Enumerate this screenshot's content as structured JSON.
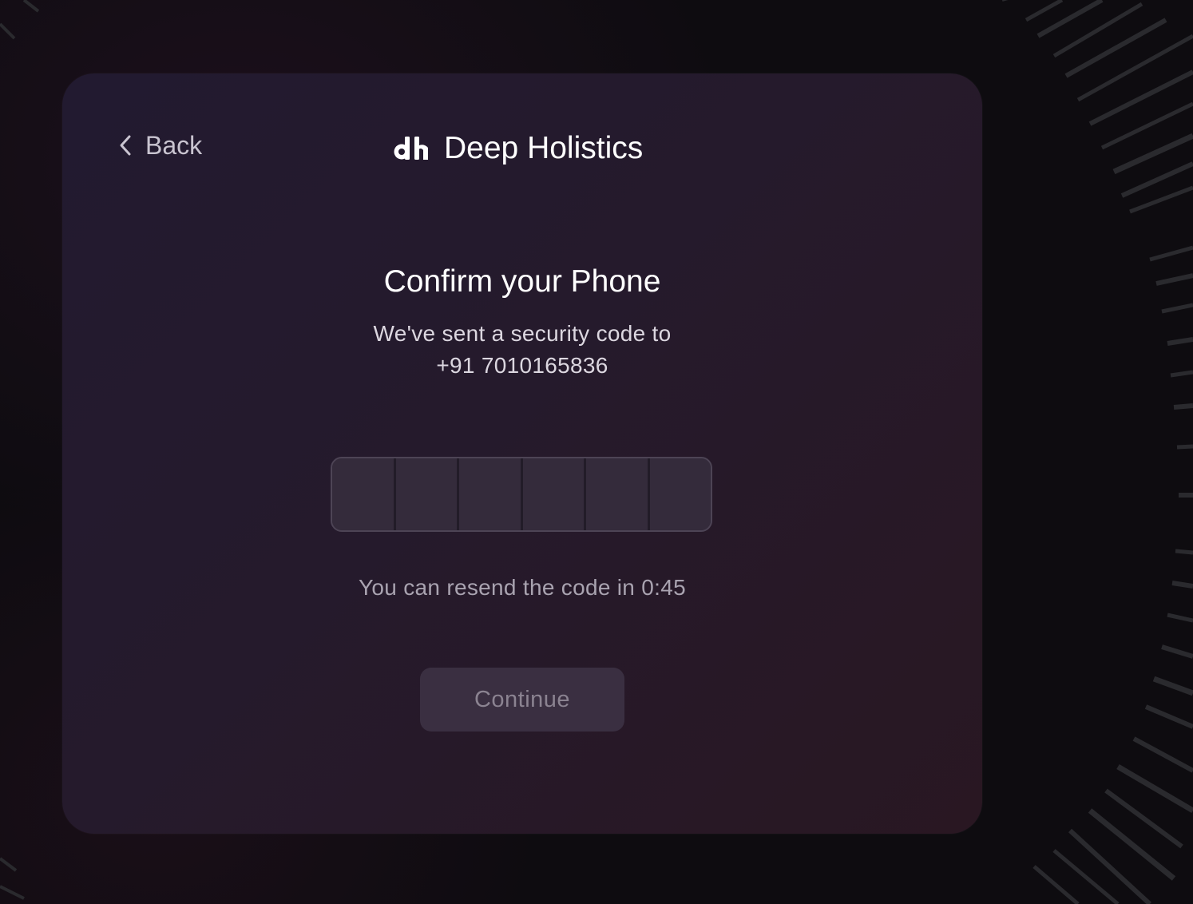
{
  "header": {
    "back_label": "Back",
    "brand_name": "Deep Holistics",
    "brand_logo_text": "dh"
  },
  "main": {
    "title": "Confirm your Phone",
    "subtitle_line1": "We've sent a security code to",
    "phone_number": "+91 7010165836",
    "otp_length": 6,
    "resend_text": "You can resend the code in 0:45",
    "continue_label": "Continue"
  },
  "icons": {
    "back": "chevron-left-icon",
    "logo": "dh-logo-icon"
  },
  "colors": {
    "background": "#0e0c10",
    "card": "#241a2e",
    "text_primary": "#ffffff",
    "text_muted": "#a9a3b0",
    "button_disabled_bg": "#3a2f41",
    "button_disabled_text": "#8b8391"
  }
}
